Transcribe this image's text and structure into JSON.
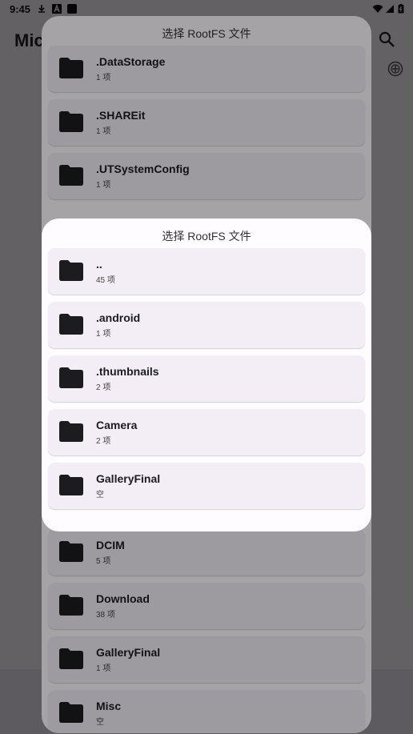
{
  "status_bar": {
    "time": "9:45"
  },
  "app": {
    "title": "Mic"
  },
  "back_dialog": {
    "title": "选择 RootFS 文件",
    "top_items": [
      {
        "name": ".DataStorage",
        "count": "1 项"
      },
      {
        "name": ".SHAREit",
        "count": "1 项"
      },
      {
        "name": ".UTSystemConfig",
        "count": "1 项"
      }
    ],
    "bottom_items": [
      {
        "name": "DCIM",
        "count": "5 项"
      },
      {
        "name": "Download",
        "count": "38 项"
      },
      {
        "name": "GalleryFinal",
        "count": "1 项"
      },
      {
        "name": "Misc",
        "count": "空"
      }
    ]
  },
  "front_dialog": {
    "title": "选择 RootFS 文件",
    "items": [
      {
        "name": "..",
        "count": "45 项"
      },
      {
        "name": ".android",
        "count": "1 项"
      },
      {
        "name": ".thumbnails",
        "count": "2 项"
      },
      {
        "name": "Camera",
        "count": "2 项"
      },
      {
        "name": "GalleryFinal",
        "count": "空"
      }
    ]
  },
  "icons": {
    "folder": "folder-icon",
    "search": "search-icon",
    "add": "add-circle-icon"
  },
  "colors": {
    "item_bg": "#f3eef6",
    "dialog_bg": "#fefcff",
    "folder": "#1c1b1f"
  }
}
